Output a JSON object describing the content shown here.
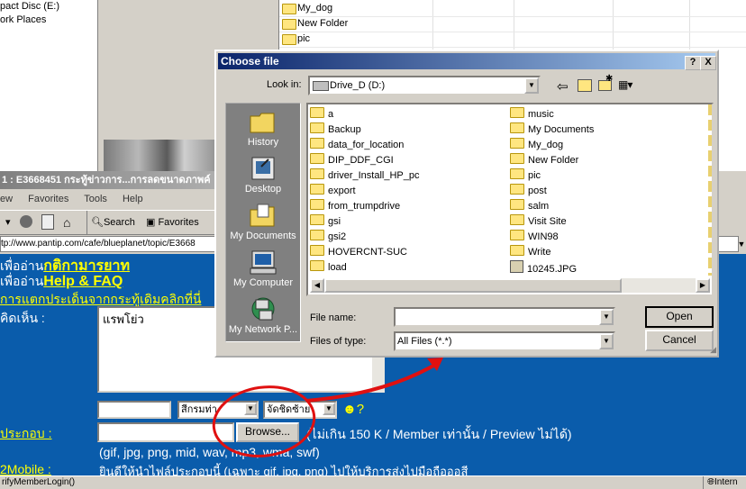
{
  "background_explorer": {
    "tree_items": [
      "pact Disc (E:)",
      "ork Places"
    ],
    "list_items": [
      "My_dog",
      "New Folder",
      "pic"
    ]
  },
  "ie_window": {
    "title": "1 : E3668451 กระทู้ข่าวการ...การลดขนาดภาพค์",
    "menu": [
      "ew",
      "Favorites",
      "Tools",
      "Help"
    ],
    "toolbar": {
      "search": "Search",
      "favorites": "Favorites"
    },
    "address": "tp://www.pantip.com/cafe/blueplanet/topic/E3668",
    "content": {
      "rules_prefix": "เพื่ออ่าน",
      "rules_link": "กติกามารยาท",
      "faq_prefix": "เพื่ออ่าน",
      "faq_link": "Help & FAQ",
      "split_text": "การแตกประเด็นจากกระทู้เดิมคลิกที่นี่",
      "comment_label": "คิดเห็น :",
      "comment_text": "แรพโย่ว",
      "font_select": "สีกรมท่า",
      "align_select": "จัดชิดซ้าย",
      "attach_label": "ประกอบ :",
      "browse_button": "Browse...",
      "limit_note": "(ไม่เกิน 150 K / Member เท่านั้น / Preview ไม่ได้)",
      "types_note": "(gif, jpg, png, mid, wav, mp3, wma, swf)",
      "mobile_label": "2Mobile :",
      "mobile_note": "ยินดีให้นำไฟล์ประกอบนี้ (เฉพาะ gif, jpg, png) ไปให้บริการส่งไปมือถือออสี"
    },
    "status_text": "rifyMemberLogin()",
    "status_zone": "Intern"
  },
  "dialog": {
    "title": "Choose file",
    "help_button": "?",
    "close_button": "X",
    "look_in_label": "Look in:",
    "look_in_value": "Drive_D (D:)",
    "places": [
      "History",
      "Desktop",
      "My Documents",
      "My Computer",
      "My Network P..."
    ],
    "files_col1": [
      "a",
      "Backup",
      "data_for_location",
      "DIP_DDF_CGI",
      "driver_Install_HP_pc",
      "export",
      "from_trumpdrive",
      "gsi",
      "gsi2",
      "HOVERCNT-SUC",
      "load"
    ],
    "files_col2": [
      "music",
      "My Documents",
      "My_dog",
      "New Folder",
      "pic",
      "post",
      "salm",
      "Visit Site",
      "WIN98",
      "Write",
      "10245.JPG"
    ],
    "file_name_label": "File name:",
    "file_name_value": "",
    "files_of_type_label": "Files of type:",
    "files_of_type_value": "All Files (*.*)",
    "open_button": "Open",
    "cancel_button": "Cancel"
  },
  "colors": {
    "page_blue": "#0a5cab",
    "link_yellow": "#ffff00",
    "annotation_red": "#e01010",
    "titlebar_blue": "#0a246a"
  }
}
